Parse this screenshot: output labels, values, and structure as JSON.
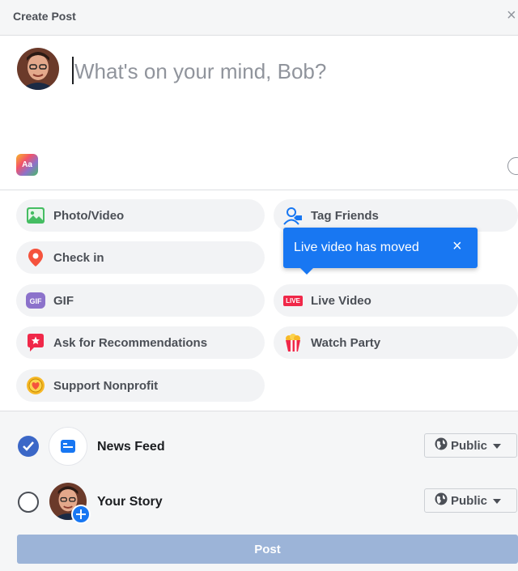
{
  "header": {
    "title": "Create Post",
    "close_label": "×"
  },
  "composer": {
    "placeholder": "What's on your mind, Bob?",
    "text_format_label": "Aa"
  },
  "options": {
    "photo_video": "Photo/Video",
    "tag_friends": "Tag Friends",
    "check_in": "Check in",
    "gif": "GIF",
    "live_video": "Live Video",
    "live_badge": "LIVE",
    "ask_recommendations": "Ask for Recommendations",
    "watch_party": "Watch Party",
    "support_nonprofit": "Support Nonprofit"
  },
  "tooltip": {
    "text": "Live video has moved",
    "close_label": "×"
  },
  "audience": {
    "news_feed": {
      "label": "News Feed",
      "privacy": "Public",
      "checked": true
    },
    "your_story": {
      "label": "Your Story",
      "privacy": "Public",
      "checked": false
    }
  },
  "post_button": "Post",
  "colors": {
    "accent": "#1877f2",
    "post_disabled": "#9cb4d8",
    "option_bg": "#f2f3f5"
  }
}
